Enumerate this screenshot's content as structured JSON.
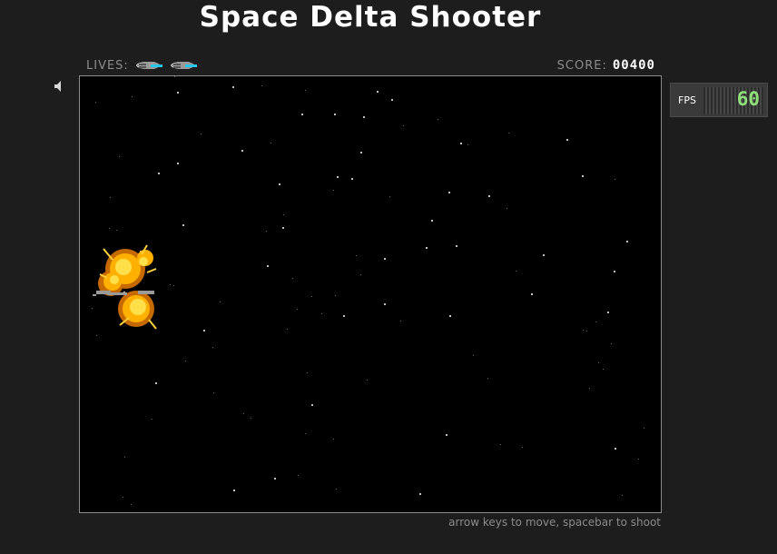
{
  "title": "Space Delta Shooter",
  "hud": {
    "lives_label": "LIVES:",
    "lives_count": 2,
    "score_label": "SCORE:",
    "score_value": "00400"
  },
  "sound": {
    "icon": "speaker-icon",
    "muted": false
  },
  "fps": {
    "label": "FPS",
    "value": "60",
    "value_color": "#8fe07a"
  },
  "instructions": "arrow keys to move, spacebar to shoot",
  "colors": {
    "background": "#1d1d1d",
    "canvas": "#000000",
    "label_gray": "#8c8c8c",
    "explosion_core": "#ffcc00",
    "explosion_edge": "#c66a00",
    "ship_accent": "#27c5e8"
  }
}
